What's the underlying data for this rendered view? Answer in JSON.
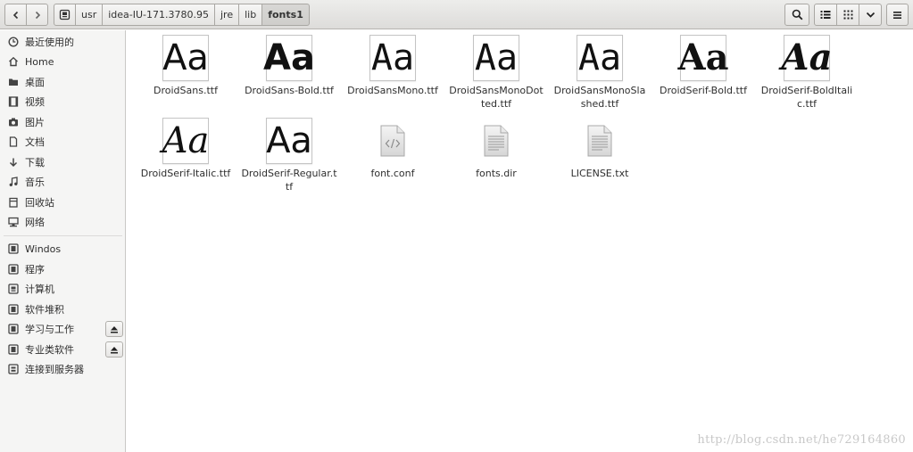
{
  "toolbar": {
    "back_icon": "chevron-left-icon",
    "forward_icon": "chevron-right-icon",
    "search_icon": "search-icon",
    "list_view_icon": "list-view-icon",
    "grid_view_icon": "grid-view-icon",
    "dropdown_icon": "chevron-down-icon",
    "menu_icon": "hamburger-menu-icon"
  },
  "breadcrumbs": [
    {
      "label": ""
    },
    {
      "label": "usr"
    },
    {
      "label": "idea-IU-171.3780.95"
    },
    {
      "label": "jre"
    },
    {
      "label": "lib"
    },
    {
      "label": "fonts1"
    }
  ],
  "sidebar": {
    "places": [
      {
        "label": "最近使用的",
        "icon": "clock-icon"
      },
      {
        "label": "Home",
        "icon": "home-icon"
      },
      {
        "label": "桌面",
        "icon": "folder-icon"
      },
      {
        "label": "视频",
        "icon": "video-icon"
      },
      {
        "label": "图片",
        "icon": "camera-icon"
      },
      {
        "label": "文档",
        "icon": "document-icon"
      },
      {
        "label": "下载",
        "icon": "download-icon"
      },
      {
        "label": "音乐",
        "icon": "music-icon"
      },
      {
        "label": "回收站",
        "icon": "trash-icon"
      },
      {
        "label": "网络",
        "icon": "network-icon"
      }
    ],
    "devices": [
      {
        "label": "Windos",
        "icon": "drive-icon"
      },
      {
        "label": "程序",
        "icon": "drive-icon"
      },
      {
        "label": "计算机",
        "icon": "computer-icon"
      },
      {
        "label": "软件堆积",
        "icon": "drive-icon"
      },
      {
        "label": "学习与工作",
        "icon": "drive-icon",
        "eject": true
      },
      {
        "label": "专业类软件",
        "icon": "drive-icon",
        "eject": true
      },
      {
        "label": "连接到服务器",
        "icon": "server-icon"
      }
    ]
  },
  "files": [
    {
      "name": "DroidSans.ttf",
      "preview": "Aa",
      "kind": "font"
    },
    {
      "name": "DroidSans-Bold.ttf",
      "preview": "Aa",
      "kind": "font"
    },
    {
      "name": "DroidSansMono.ttf",
      "preview": "Aa",
      "kind": "font"
    },
    {
      "name": "DroidSansMonoDotted.ttf",
      "preview": "Aa",
      "kind": "font"
    },
    {
      "name": "DroidSansMonoSlashed.ttf",
      "preview": "Aa",
      "kind": "font"
    },
    {
      "name": "DroidSerif-Bold.ttf",
      "preview": "Aa",
      "kind": "font"
    },
    {
      "name": "DroidSerif-BoldItalic.ttf",
      "preview": "Aa",
      "kind": "font"
    },
    {
      "name": "DroidSerif-Italic.ttf",
      "preview": "Aa",
      "kind": "font"
    },
    {
      "name": "DroidSerif-Regular.ttf",
      "preview": "Aa",
      "kind": "font"
    },
    {
      "name": "font.conf",
      "kind": "code-file"
    },
    {
      "name": "fonts.dir",
      "kind": "text-file"
    },
    {
      "name": "LICENSE.txt",
      "kind": "text-file"
    }
  ],
  "watermark": "http://blog.csdn.net/he729164860"
}
